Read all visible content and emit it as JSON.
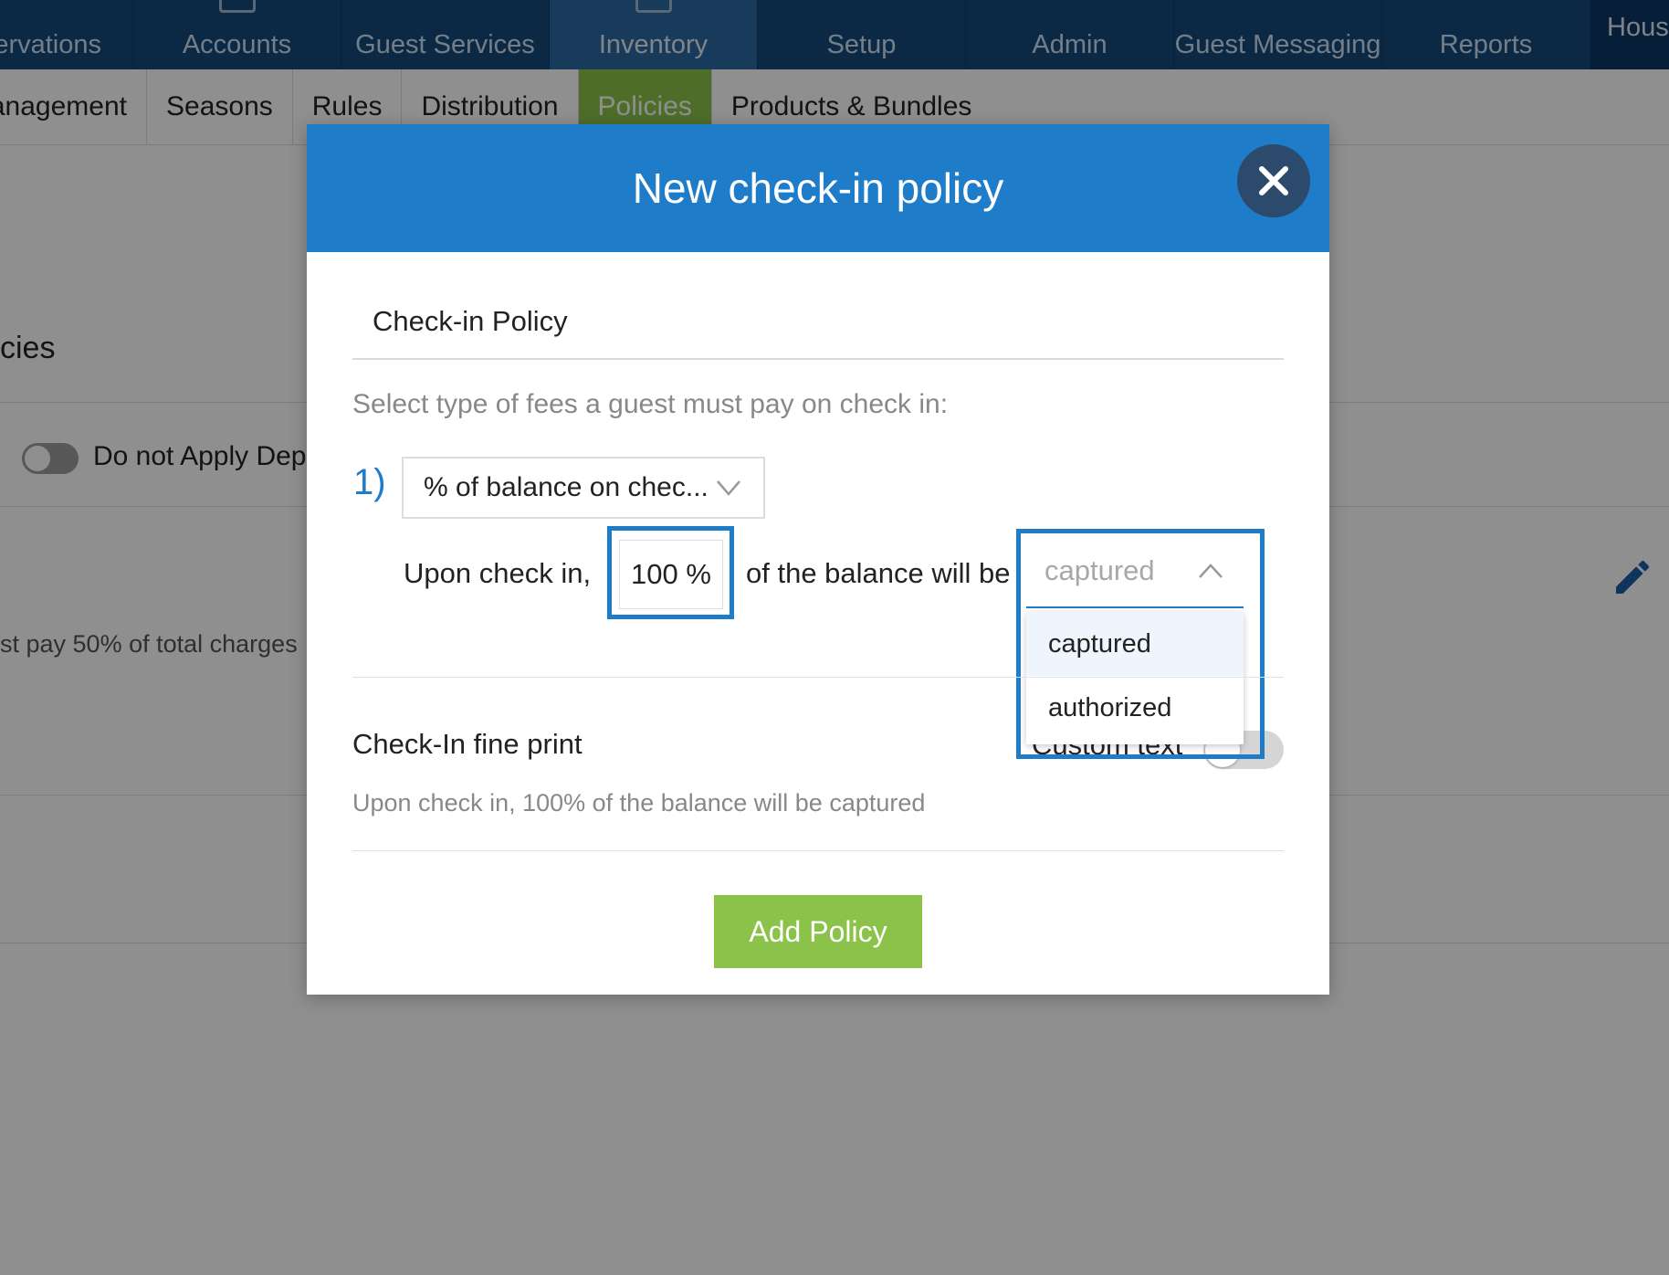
{
  "top_nav": {
    "tabs": [
      {
        "label": "ervations"
      },
      {
        "label": "Accounts"
      },
      {
        "label": "Guest Services"
      },
      {
        "label": "Inventory"
      },
      {
        "label": "Setup"
      },
      {
        "label": "Admin"
      },
      {
        "label": "Guest Messaging"
      },
      {
        "label": "Reports"
      },
      {
        "label": "Hous"
      }
    ],
    "active": "Inventory"
  },
  "sub_nav": {
    "tabs": [
      {
        "label": "anagement"
      },
      {
        "label": "Seasons"
      },
      {
        "label": "Rules"
      },
      {
        "label": "Distribution"
      },
      {
        "label": "Policies"
      },
      {
        "label": "Products & Bundles"
      }
    ],
    "active": "Policies"
  },
  "background": {
    "heading": "cies",
    "toggle_label": "Do not Apply Dep",
    "description": "st pay 50% of total charges"
  },
  "modal": {
    "title": "New check-in policy",
    "section_title": "Check-in Policy",
    "instruction": "Select type of fees a guest must pay on check in:",
    "step_number": "1)",
    "fee_type": {
      "value": "% of balance on chec..."
    },
    "upon_label": "Upon check in,",
    "percent_value": "100 %",
    "balance_label": "of the balance will be",
    "capture_select": {
      "value": "captured",
      "options": [
        "captured",
        "authorized"
      ]
    },
    "fine_print_title": "Check-In fine print",
    "custom_text_label": "Custom text",
    "fine_print_text": "Upon check in, 100% of the balance will be captured",
    "add_button": "Add Policy"
  },
  "colors": {
    "nav_bg": "#154a7c",
    "header_blue": "#1e7cc8",
    "green": "#8bc34a",
    "close_bg": "#2c4a6b"
  }
}
